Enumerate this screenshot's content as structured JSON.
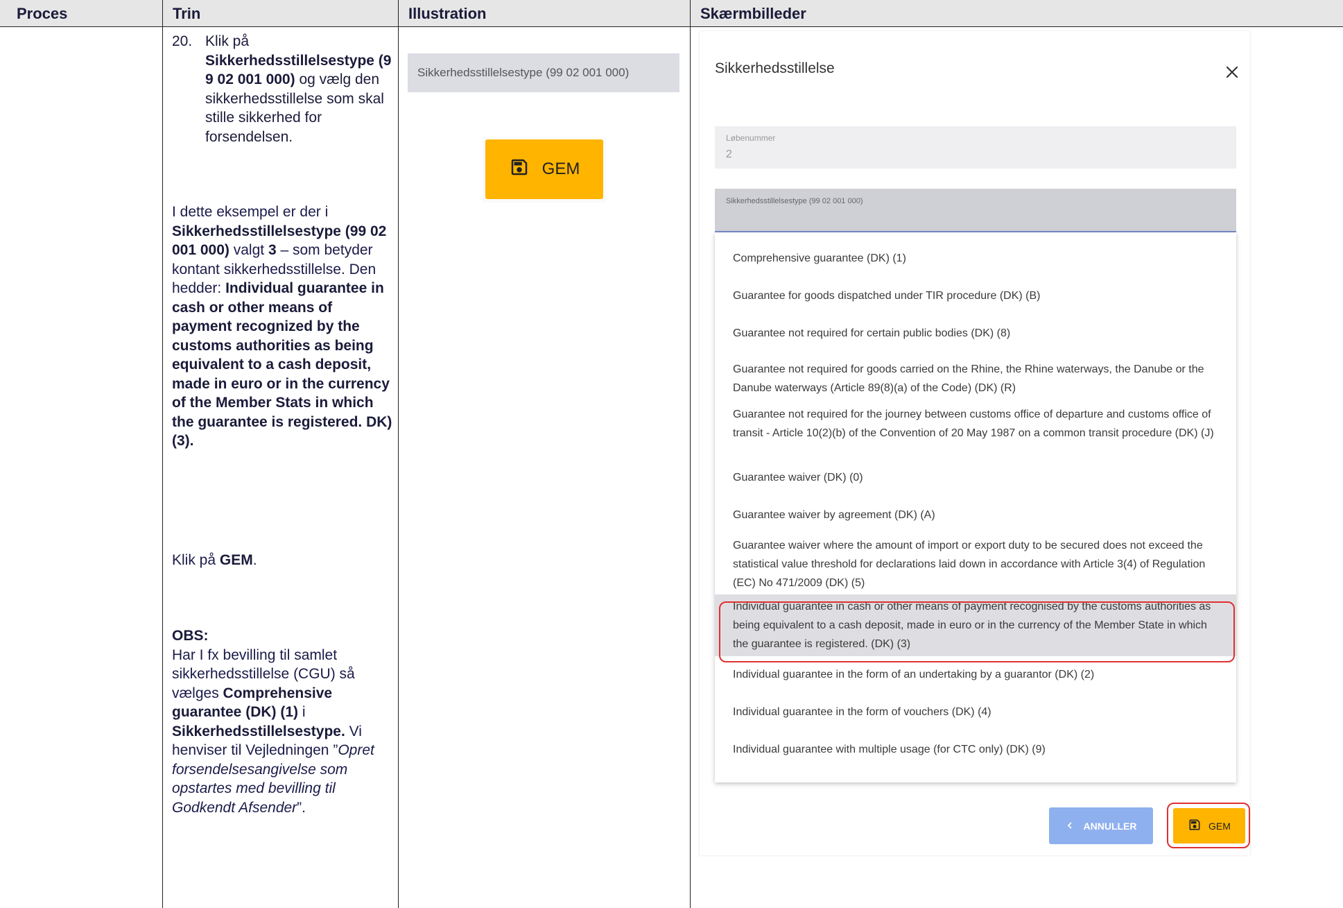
{
  "header": {
    "col1": "Proces",
    "col2": "Trin",
    "col3": "Illustration",
    "col4": "Skærmbilleder"
  },
  "trin": {
    "step_number": "20.",
    "step_pre": "Klik på",
    "step_field": "Sikkerhedsstillelsestype (99 02 001 000)",
    "step_post": "og vælg den sikkerhedsstillelse som skal stille sikkerhed for forsendelsen.",
    "example_pre": "I dette eksempel er der i",
    "example_field": "Sikkerhedsstillelsestype (99 02 001 000)",
    "example_mid1": "valgt",
    "example_value": "3",
    "example_mid2": "– som betyder kontant sikkerhedsstillelse. Den hedder:",
    "example_name": "Individual guarantee in cash or other means of payment recognized by the customs authorities as being equivalent to a cash deposit, made in euro or in the currency of the Member Stats in which the guarantee is registered. DK) (3).",
    "click_pre": "Klik på",
    "click_button": "GEM",
    "obs_title": "OBS:",
    "obs_text1": "Har I fx bevilling til samlet sikkerhedsstillelse (CGU) så vælges",
    "obs_option": "Comprehensive guarantee (DK) (1)",
    "obs_in": "i",
    "obs_field": "Sikkerhedsstillelsestype.",
    "obs_text2": "Vi henviser til Vejledningen ”",
    "obs_guide": "Opret forsendelsesangivelse som opstartes med bevilling til Godkendt Afsender",
    "obs_end": "”."
  },
  "illustration": {
    "field_label": "Sikkerhedsstillelsestype (99 02 001 000)",
    "button_label": "GEM"
  },
  "dialog": {
    "title": "Sikkerhedsstillelse",
    "lobenummer_label": "Løbenummer",
    "lobenummer_value": "2",
    "type_label": "Sikkerhedsstillelsestype (99 02 001 000)",
    "options": [
      "Comprehensive guarantee (DK) (1)",
      "Guarantee for goods dispatched under TIR procedure (DK) (B)",
      "Guarantee not required for certain public bodies (DK) (8)",
      "Guarantee not required for goods carried on the Rhine, the Rhine waterways, the Danube or the Danube waterways (Article 89(8)(a) of the Code) (DK) (R)",
      "Guarantee not required for the journey between customs office of departure and customs office of transit - Article 10(2)(b) of the Convention of 20 May 1987 on a common transit procedure (DK) (J)",
      "Guarantee waiver (DK) (0)",
      "Guarantee waiver by agreement (DK) (A)",
      "Guarantee waiver where the amount of import or export duty to be secured does not exceed the statistical value threshold for declarations laid down in accordance with Article 3(4) of Regulation (EC) No 471/2009 (DK) (5)",
      "Individual guarantee in cash or other means of payment recognised by the customs authorities as being equivalent to a cash deposit, made in euro or in the currency of the Member State in which the guarantee is registered. (DK) (3)",
      "Individual guarantee in the form of an undertaking by a guarantor (DK) (2)",
      "Individual guarantee in the form of vouchers (DK) (4)",
      "Individual guarantee with multiple usage (for CTC only) (DK) (9)"
    ],
    "selected_index": 8,
    "cancel_label": "ANNULLER",
    "save_label": "GEM"
  },
  "colors": {
    "accent_yellow": "#ffb400",
    "cancel_blue": "#8fb0ee",
    "highlight_red": "#e03030",
    "header_gray": "#e6e6e6"
  }
}
